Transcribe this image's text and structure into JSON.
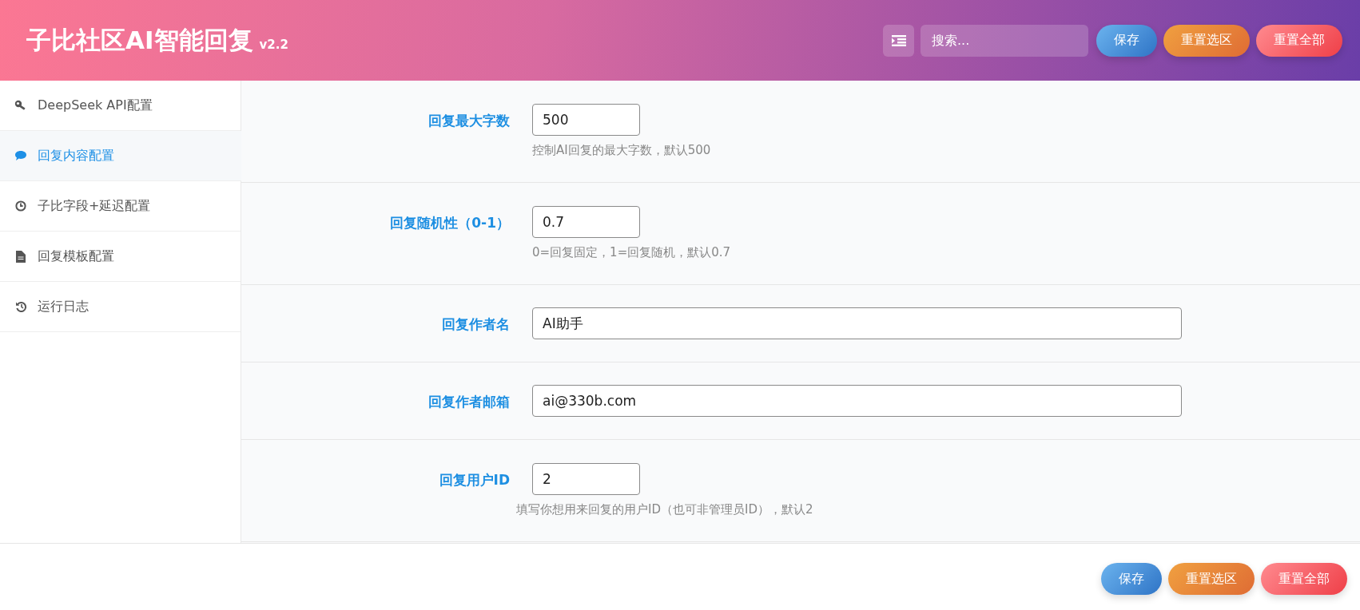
{
  "header": {
    "title": "子比社区AI智能回复",
    "version": "v2.2",
    "search": {
      "placeholder": "搜索..."
    },
    "buttons": [
      {
        "label": "保存",
        "kind": "save"
      },
      {
        "label": "重置选区",
        "kind": "reset-section"
      },
      {
        "label": "重置全部",
        "kind": "reset-all"
      }
    ]
  },
  "sidebar": {
    "items": [
      {
        "label": "DeepSeek API配置",
        "selected": false
      },
      {
        "label": "回复内容配置",
        "selected": true
      },
      {
        "label": "子比字段+延迟配置",
        "selected": false
      },
      {
        "label": "回复模板配置",
        "selected": false
      },
      {
        "label": "运行日志",
        "selected": false
      }
    ]
  },
  "fields": [
    {
      "label": "回复最大字数",
      "value": "500",
      "hint": "控制AI回复的最大字数，默认500",
      "kind": "short"
    },
    {
      "label": "回复随机性（0-1）",
      "value": "0.7",
      "hint": "0=回复固定，1=回复随机，默认0.7",
      "kind": "short"
    },
    {
      "label": "回复作者名",
      "value": "AI助手",
      "kind": "wide"
    },
    {
      "label": "回复作者邮箱",
      "value": "ai@330b.com",
      "kind": "wide"
    },
    {
      "label": "回复用户ID",
      "value": "2",
      "hint": "填写你想用来回复的用户ID（也可非管理员ID），默认2",
      "kind": "short"
    }
  ],
  "footer": {
    "buttons": [
      {
        "label": "保存",
        "kind": "save"
      },
      {
        "label": "重置选区",
        "kind": "reset-section"
      },
      {
        "label": "重置全部",
        "kind": "reset-all"
      }
    ]
  }
}
